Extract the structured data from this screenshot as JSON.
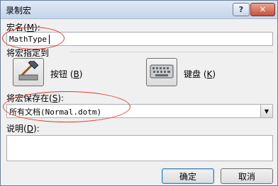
{
  "window": {
    "title": "录制宏"
  },
  "titlebar": {
    "help_glyph": "?",
    "close_glyph": "✕"
  },
  "macro_name": {
    "label_prefix": "宏名(",
    "label_key": "M",
    "label_suffix": "):",
    "value": "MathType"
  },
  "assign": {
    "label": "将宏指定到"
  },
  "button_option": {
    "label_prefix": "按钮 (",
    "label_key": "B",
    "label_suffix": ")"
  },
  "keyboard_option": {
    "label_prefix": "键盘 (",
    "label_key": "K",
    "label_suffix": ")"
  },
  "store_in": {
    "label_prefix": "将宏保存在(",
    "label_key": "S",
    "label_suffix": "):",
    "selected": "所有文档(Normal.dotm)"
  },
  "description": {
    "label_prefix": "说明(",
    "label_key": "D",
    "label_suffix": "):",
    "value": ""
  },
  "actions": {
    "ok": "确定",
    "cancel": "取消"
  },
  "colors": {
    "highlight": "#e83a2f",
    "accent": "#3c7fb1"
  }
}
